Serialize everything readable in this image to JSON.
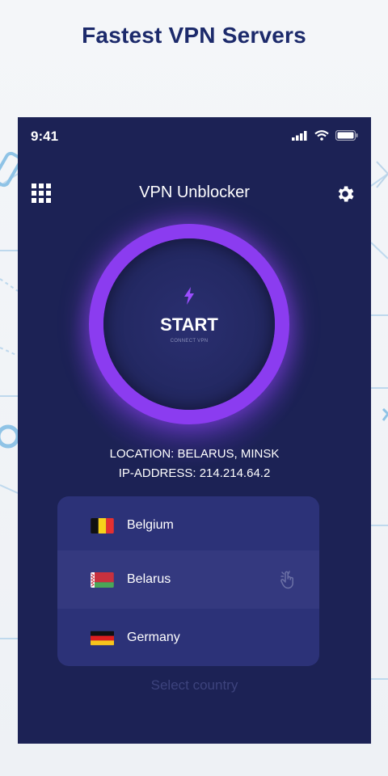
{
  "promo": {
    "title": "Fastest VPN Servers"
  },
  "status_bar": {
    "time": "9:41"
  },
  "header": {
    "title": "VPN Unblocker"
  },
  "start_button": {
    "label": "START",
    "sublabel": "CONNECT VPN"
  },
  "info": {
    "location": "LOCATION: BELARUS, MINSK",
    "ip_address": "IP-ADDRESS: 214.214.64.2"
  },
  "countries": [
    {
      "name": "Belgium",
      "selected": false
    },
    {
      "name": "Belarus",
      "selected": true
    },
    {
      "name": "Germany",
      "selected": false
    }
  ],
  "select_country_label": "Select country",
  "colors": {
    "background": "#1c2255",
    "accent": "#8b3cf0",
    "list_bg": "#2c3278",
    "selected_row": "#34397f"
  },
  "icons": [
    "grid-menu-icon",
    "gear-icon",
    "lightning-bolt-icon",
    "signal-icon",
    "wifi-icon",
    "battery-icon",
    "tap-hand-icon"
  ]
}
